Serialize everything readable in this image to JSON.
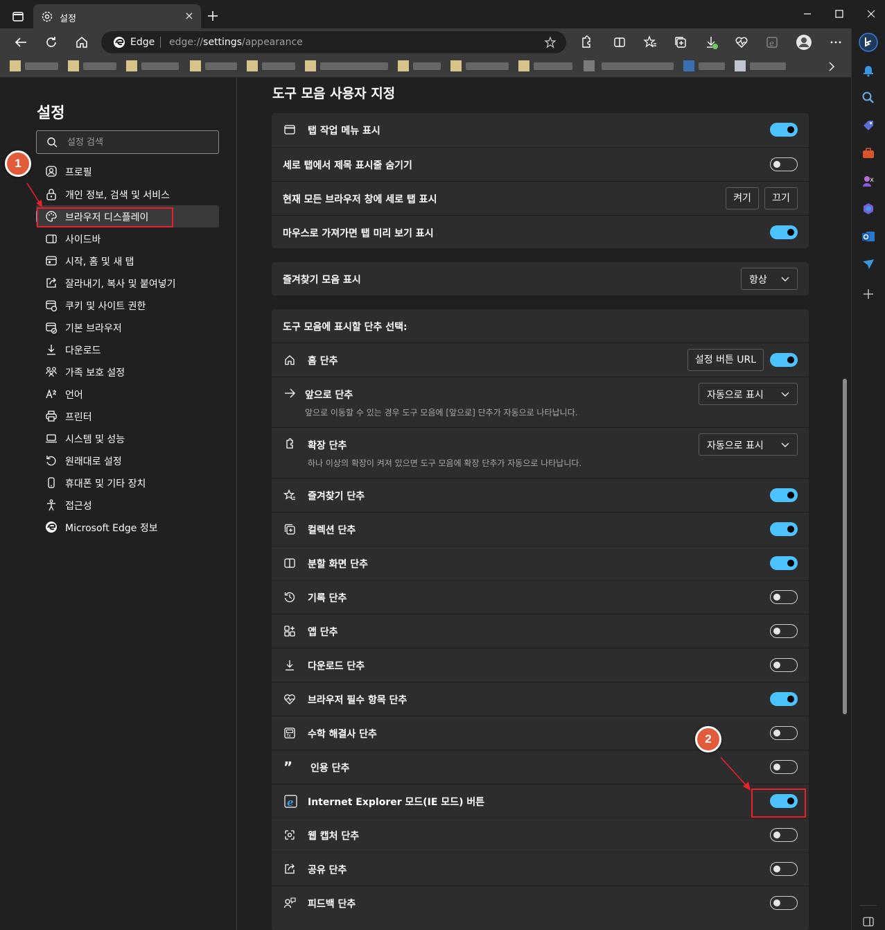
{
  "window": {
    "tab_title": "설정",
    "tab_close": "×",
    "address_brand": "Edge",
    "url_prefix": "edge://",
    "url_highlight": "settings",
    "url_suffix": "/appearance"
  },
  "nav": {
    "title": "설정",
    "search_placeholder": "설정 검색",
    "items": [
      {
        "label": "프로필",
        "icon": "profile-icon"
      },
      {
        "label": "개인 정보, 검색 및 서비스",
        "icon": "lock-icon"
      },
      {
        "label": "브라우저 디스플레이",
        "icon": "palette-icon",
        "active": true
      },
      {
        "label": "사이드바",
        "icon": "sidebar-icon"
      },
      {
        "label": "시작, 홈 및 새 탭",
        "icon": "start-page-icon"
      },
      {
        "label": "잘라내기, 복사 및 붙여넣기",
        "icon": "share-paste-icon"
      },
      {
        "label": "쿠키 및 사이트 권한",
        "icon": "cookie-permissions-icon"
      },
      {
        "label": "기본 브라우저",
        "icon": "default-browser-icon"
      },
      {
        "label": "다운로드",
        "icon": "download-icon"
      },
      {
        "label": "가족 보호 설정",
        "icon": "family-icon"
      },
      {
        "label": "언어",
        "icon": "language-icon"
      },
      {
        "label": "프린터",
        "icon": "printer-icon"
      },
      {
        "label": "시스템 및 성능",
        "icon": "laptop-icon"
      },
      {
        "label": "원래대로 설정",
        "icon": "reset-icon"
      },
      {
        "label": "휴대폰 및 기타 장치",
        "icon": "phone-icon"
      },
      {
        "label": "접근성",
        "icon": "accessibility-icon"
      },
      {
        "label": "Microsoft Edge 정보",
        "icon": "edge-logo-icon"
      }
    ]
  },
  "main": {
    "section_title": "도구 모음 사용자 지정",
    "card1": [
      {
        "label": "탭 작업 메뉴 표시",
        "icon": "tab-actions-icon",
        "toggle": true
      },
      {
        "label": "세로 탭에서 제목 표시줄 숨기기",
        "toggle": false
      },
      {
        "label": "현재 모든 브라우저 창에 세로 탭 표시",
        "btn_on": "켜기",
        "btn_off": "끄기"
      },
      {
        "label": "마우스로 가져가면 탭 미리 보기 표시",
        "toggle": true
      }
    ],
    "favorites_bar": {
      "label": "즐겨찾기 모음 표시",
      "value": "항상"
    },
    "buttons_heading": "도구 모음에 표시할 단추 선택:",
    "home": {
      "label": "홈 단추",
      "button": "설정 버튼 URL",
      "toggle": true
    },
    "forward": {
      "label": "앞으로 단추",
      "desc": "앞으로 이동할 수 있는 경우 도구 모음에 [앞으로] 단추가 자동으로 나타납니다.",
      "value": "자동으로 표시"
    },
    "extensions": {
      "label": "확장 단추",
      "desc": "하나 이상의 확장이 켜져 있으면 도구 모음에 확장 단추가 자동으로 나타납니다.",
      "value": "자동으로 표시"
    },
    "toggles": [
      {
        "label": "즐겨찾기 단추",
        "icon": "favorites-icon",
        "on": true
      },
      {
        "label": "컬렉션 단추",
        "icon": "collections-icon",
        "on": true
      },
      {
        "label": "분할 화면 단추",
        "icon": "split-screen-icon",
        "on": true
      },
      {
        "label": "기록 단추",
        "icon": "history-icon",
        "on": false
      },
      {
        "label": "앱 단추",
        "icon": "apps-icon",
        "on": false
      },
      {
        "label": "다운로드 단추",
        "icon": "download-icon",
        "on": false
      },
      {
        "label": "브라우저 필수 항목 단추",
        "icon": "heart-pulse-icon",
        "on": true
      },
      {
        "label": "수학 해결사 단추",
        "icon": "math-solver-icon",
        "on": false
      },
      {
        "label": "인용 단추",
        "icon": "quote-icon",
        "on": false
      },
      {
        "label": "Internet Explorer 모드(IE 모드) 버튼",
        "icon": "ie-mode-icon",
        "on": true
      },
      {
        "label": "웹 캡처 단추",
        "icon": "web-capture-icon",
        "on": false
      },
      {
        "label": "공유 단추",
        "icon": "share-icon",
        "on": false
      },
      {
        "label": "피드백 단추",
        "icon": "feedback-icon",
        "on": false
      }
    ]
  },
  "annotations": {
    "badge1": "1",
    "badge2": "2"
  },
  "colors": {
    "accent": "#4cc2ff",
    "highlight": "#e8202a",
    "badge": "#e25b3a"
  }
}
